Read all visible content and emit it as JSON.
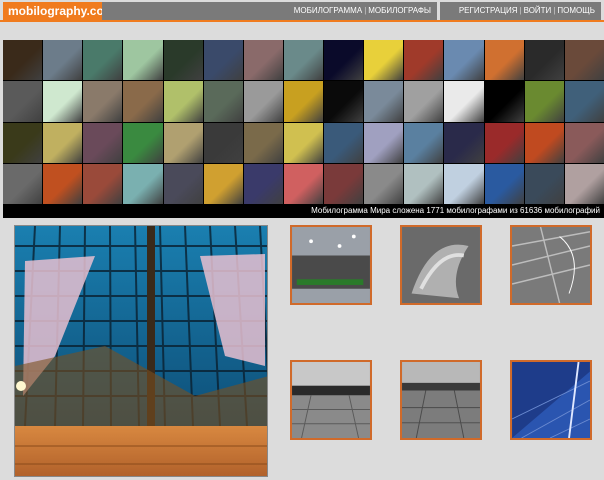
{
  "header": {
    "logo": "mobilography.com",
    "nav_left": [
      {
        "label": "МОБИЛОГРАММА"
      },
      {
        "label": "МОБИЛОГРАФЫ"
      }
    ],
    "nav_right": [
      {
        "label": "РЕГИСТРАЦИЯ"
      },
      {
        "label": "ВОЙТИ"
      },
      {
        "label": "ПОМОЩЬ"
      }
    ],
    "accent": "#f07b1e"
  },
  "mosaic": {
    "caption": "Мобилограмма Мира сложена 1771 мобилографами из 61636 мобилографий",
    "tile_colors": [
      "#3a2a1a",
      "#6c7c8a",
      "#4a7a6a",
      "#9ec6a0",
      "#2a3a2a",
      "#3a4a6a",
      "#8a6a6a",
      "#6a8a8a",
      "#0a0a2a",
      "#e8d03a",
      "#a03a2a",
      "#6a8ab0",
      "#d07030",
      "#2a2a2a",
      "#6a4a3a",
      "#5a5a5a",
      "#cfe8cf",
      "#8a7a6a",
      "#8a6a4a",
      "#b0c06a",
      "#5a6a5a",
      "#9a9a9a",
      "#c8a020",
      "#0a0a0a",
      "#7a8a9a",
      "#a0a0a0",
      "#eaeaea",
      "#000000",
      "#6a8a30",
      "#40607a",
      "#3a3a1a",
      "#c0b060",
      "#6a4a5a",
      "#3a8a40",
      "#b0a070",
      "#3a3a3a",
      "#7a6a4a",
      "#d0c050",
      "#3a5a7a",
      "#a0a0c0",
      "#5a80a0",
      "#2a2a4a",
      "#9a2a2a",
      "#c04a20",
      "#8a5a5a",
      "#6a6a6a",
      "#c05020",
      "#9a4a3a",
      "#7ab0b0",
      "#4a4a5a",
      "#d0a030",
      "#3a3a6a",
      "#d06060",
      "#7a3a3a",
      "#8a8a8a",
      "#b0c0c0",
      "#c0d0e0",
      "#2a5aa0",
      "#3a4a5a",
      "#b0a0a0"
    ]
  },
  "main_photo": {
    "label": "Photo of a glass dome ceiling"
  },
  "thumbnails": [
    {
      "label": "rainy window"
    },
    {
      "label": "blurred hand"
    },
    {
      "label": "cracked glass"
    },
    {
      "label": "station platform"
    },
    {
      "label": "station platform 2"
    },
    {
      "label": "blue glass building"
    }
  ]
}
